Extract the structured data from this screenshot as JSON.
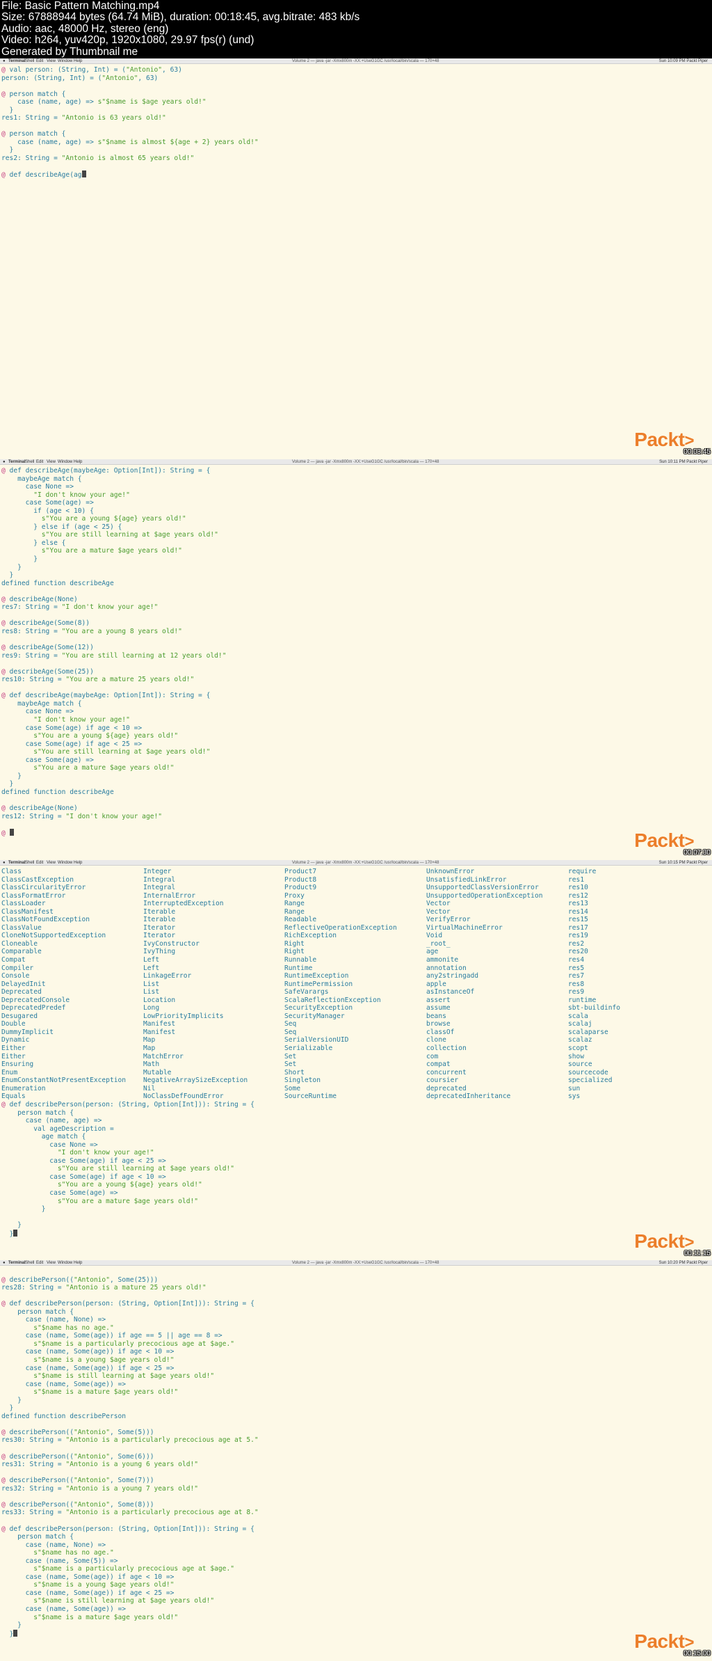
{
  "header": {
    "lines": [
      "File: Basic Pattern Matching.mp4",
      "Size: 67888944 bytes (64.74 MiB), duration: 00:18:45, avg.bitrate: 483 kb/s",
      "Audio: aac, 48000 Hz, stereo (eng)",
      "Video: h264, yuv420p, 1920x1080, 29.97 fps(r) (und)",
      "Generated by Thumbnail me"
    ]
  },
  "menubar": {
    "items": [
      "Terminal",
      "Shell",
      "Edit",
      "View",
      "Window",
      "Help"
    ],
    "titles": [
      "Volume 2 — java -jar -Xmx800m -XX:+UseG1GC /usr/local/bin/scala — 170×48",
      "Volume 2 — java -jar -Xmx800m -XX:+UseG1GC /usr/local/bin/scala — 170×48",
      "Volume 2 — java -jar -Xmx800m -XX:+UseG1GC /usr/local/bin/scala — 170×48",
      "Volume 2 — java -jar -Xmx800m -XX:+UseG1GC /usr/local/bin/scala — 170×48"
    ],
    "clocks": [
      "Sun 10:09 PM   Packt Piper",
      "Sun 10:11 PM   Packt Piper",
      "Sun 10:15 PM   Packt Piper",
      "Sun 10:20 PM   Packt Piper"
    ]
  },
  "logo": {
    "text": "Packt",
    "arrow": ">"
  },
  "timestamps": [
    "00:03:45",
    "00:07:30",
    "00:11:15",
    "00:15:00"
  ],
  "frame1": [
    "@ val person: (String, Int) = (\"Antonio\", 63)",
    "person: (String, Int) = (\"Antonio\", 63)",
    "",
    "@ person match {",
    "    case (name, age) => s\"$name is $age years old!\"",
    "  }",
    "res1: String = \"Antonio is 63 years old!\"",
    "",
    "@ person match {",
    "    case (name, age) => s\"$name is almost ${age + 2} years old!\"",
    "  }",
    "res2: String = \"Antonio is almost 65 years old!\"",
    "",
    "@ def describeAge(ag"
  ],
  "frame2": [
    "@ def describeAge(maybeAge: Option[Int]): String = {",
    "    maybeAge match {",
    "      case None =>",
    "        \"I don't know your age!\"",
    "      case Some(age) =>",
    "        if (age < 10) {",
    "          s\"You are a young ${age} years old!\"",
    "        } else if (age < 25) {",
    "          s\"You are still learning at $age years old!\"",
    "        } else {",
    "          s\"You are a mature $age years old!\"",
    "        }",
    "    }",
    "  }",
    "defined function describeAge",
    "",
    "@ describeAge(None)",
    "res7: String = \"I don't know your age!\"",
    "",
    "@ describeAge(Some(8))",
    "res8: String = \"You are a young 8 years old!\"",
    "",
    "@ describeAge(Some(12))",
    "res9: String = \"You are still learning at 12 years old!\"",
    "",
    "@ describeAge(Some(25))",
    "res10: String = \"You are a mature 25 years old!\"",
    "",
    "@ def describeAge(maybeAge: Option[Int]): String = {",
    "    maybeAge match {",
    "      case None =>",
    "        \"I don't know your age!\"",
    "      case Some(age) if age < 10 =>",
    "        s\"You are a young ${age} years old!\"",
    "      case Some(age) if age < 25 =>",
    "        s\"You are still learning at $age years old!\"",
    "      case Some(age) =>",
    "        s\"You are a mature $age years old!\"",
    "    }",
    "  }",
    "defined function describeAge",
    "",
    "@ describeAge(None)",
    "res12: String = \"I don't know your age!\"",
    "",
    "@ "
  ],
  "frame3": {
    "col1": [
      "Class",
      "ClassCastException",
      "ClassCircularityError",
      "ClassFormatError",
      "ClassLoader",
      "ClassManifest",
      "ClassNotFoundException",
      "ClassValue",
      "CloneNotSupportedException",
      "Cloneable",
      "Comparable",
      "Compat",
      "Compiler",
      "Console",
      "DelayedInit",
      "Deprecated",
      "DeprecatedConsole",
      "DeprecatedPredef",
      "Desugared",
      "Double",
      "DummyImplicit",
      "Dynamic",
      "Either",
      "Either",
      "Ensuring",
      "Enum",
      "EnumConstantNotPresentException",
      "Enumeration",
      "Equals"
    ],
    "col2": [
      "Integer",
      "Integral",
      "Integral",
      "InternalError",
      "InterruptedException",
      "Iterable",
      "Iterable",
      "Iterator",
      "Iterator",
      "IvyConstructor",
      "IvyThing",
      "Left",
      "Left",
      "LinkageError",
      "List",
      "List",
      "Location",
      "Long",
      "LowPriorityImplicits",
      "Manifest",
      "Manifest",
      "Map",
      "Map",
      "MatchError",
      "Math",
      "Mutable",
      "NegativeArraySizeException",
      "Nil",
      "NoClassDefFoundError"
    ],
    "col3": [
      "Product7",
      "Product8",
      "Product9",
      "Proxy",
      "Range",
      "Range",
      "Readable",
      "ReflectiveOperationException",
      "RichException",
      "Right",
      "Right",
      "Runnable",
      "Runtime",
      "RuntimeException",
      "RuntimePermission",
      "SafeVarargs",
      "ScalaReflectionException",
      "SecurityException",
      "SecurityManager",
      "Seq",
      "Seq",
      "SerialVersionUID",
      "Serializable",
      "Set",
      "Set",
      "Short",
      "Singleton",
      "Some",
      "SourceRuntime"
    ],
    "col4": [
      "UnknownError",
      "UnsatisfiedLinkError",
      "UnsupportedClassVersionError",
      "UnsupportedOperationException",
      "Vector",
      "Vector",
      "VerifyError",
      "VirtualMachineError",
      "Void",
      "_root_",
      "age",
      "ammonite",
      "annotation",
      "any2stringadd",
      "apple",
      "asInstanceOf",
      "assert",
      "assume",
      "beans",
      "browse",
      "classOf",
      "clone",
      "collection",
      "com",
      "compat",
      "concurrent",
      "coursier",
      "deprecated",
      "deprecatedInheritance"
    ],
    "col5": [
      "require",
      "res1",
      "res10",
      "res12",
      "res13",
      "res14",
      "res15",
      "res17",
      "res19",
      "res2",
      "res20",
      "res4",
      "res5",
      "res7",
      "res8",
      "res9",
      "runtime",
      "sbt-buildinfo",
      "scala",
      "scalaj",
      "scalaparse",
      "scalaz",
      "scopt",
      "show",
      "source",
      "sourcecode",
      "specialized",
      "sun",
      "sys"
    ],
    "code": [
      "@ def describePerson(person: (String, Option[Int])): String = {",
      "    person match {",
      "      case (name, age) =>",
      "        val ageDescription =",
      "          age match {",
      "            case None =>",
      "              \"I don't know your age!\"",
      "            case Some(age) if age < 25 =>",
      "              s\"You are still learning at $age years old!\"",
      "            case Some(age) if age < 10 =>",
      "              s\"You are a young ${age} years old!\"",
      "            case Some(age) =>",
      "              s\"You are a mature $age years old!\"",
      "          }",
      "      ",
      "    }",
      "  }"
    ]
  },
  "frame4": [
    "",
    "@ describePerson((\"Antonio\", Some(25)))",
    "res28: String = \"Antonio is a mature 25 years old!\"",
    "",
    "@ def describePerson(person: (String, Option[Int])): String = {",
    "    person match {",
    "      case (name, None) =>",
    "        s\"$name has no age.\"",
    "      case (name, Some(age)) if age == 5 || age == 8 =>",
    "        s\"$name is a particularly precocious age at $age.\"",
    "      case (name, Some(age)) if age < 10 =>",
    "        s\"$name is a young $age years old!\"",
    "      case (name, Some(age)) if age < 25 =>",
    "        s\"$name is still learning at $age years old!\"",
    "      case (name, Some(age)) =>",
    "        s\"$name is a mature $age years old!\"",
    "    }",
    "  }",
    "defined function describePerson",
    "",
    "@ describePerson((\"Antonio\", Some(5)))",
    "res30: String = \"Antonio is a particularly precocious age at 5.\"",
    "",
    "@ describePerson((\"Antonio\", Some(6)))",
    "res31: String = \"Antonio is a young 6 years old!\"",
    "",
    "@ describePerson((\"Antonio\", Some(7)))",
    "res32: String = \"Antonio is a young 7 years old!\"",
    "",
    "@ describePerson((\"Antonio\", Some(8)))",
    "res33: String = \"Antonio is a particularly precocious age at 8.\"",
    "",
    "@ def describePerson(person: (String, Option[Int])): String = {",
    "    person match {",
    "      case (name, None) =>",
    "        s\"$name has no age.\"",
    "      case (name, Some(5)) =>",
    "        s\"$name is a particularly precocious age at $age.\"",
    "      case (name, Some(age)) if age < 10 =>",
    "        s\"$name is a young $age years old!\"",
    "      case (name, Some(age)) if age < 25 =>",
    "        s\"$name is still learning at $age years old!\"",
    "      case (name, Some(age)) =>",
    "        s\"$name is a mature $age years old!\"",
    "    }",
    "  }"
  ],
  "colors": {
    "prompt": "#c2377c",
    "string": "#4a9c2e",
    "type": "#2a7da0",
    "logo": "#ec7e2a",
    "background": "#fdf9e7"
  }
}
